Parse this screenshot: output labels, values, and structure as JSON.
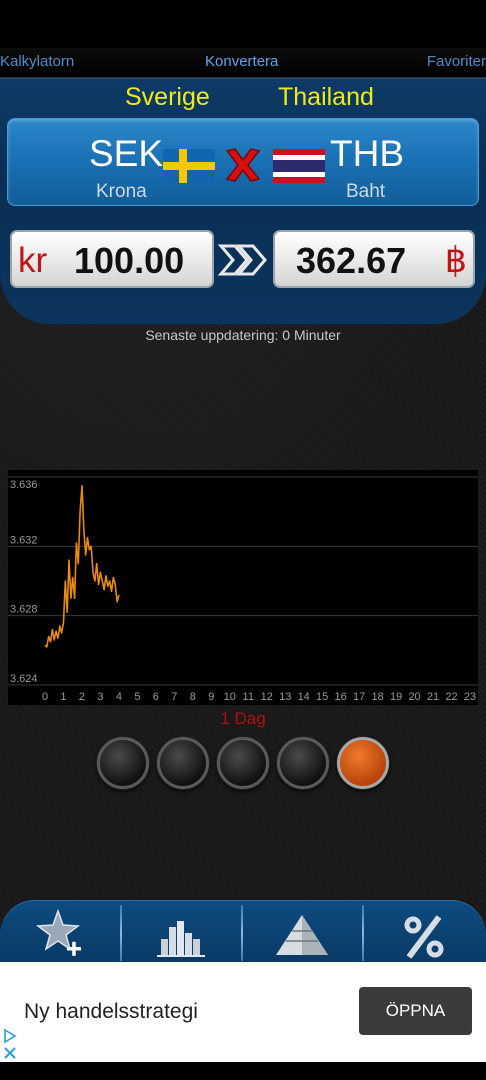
{
  "top_nav": {
    "left": "Kalkylatorn",
    "center": "Konvertera",
    "right": "Favoriter"
  },
  "pair": {
    "from": {
      "country": "Sverige",
      "code": "SEK",
      "name": "Krona",
      "symbol": "kr",
      "amount": "100.00"
    },
    "to": {
      "country": "Thailand",
      "code": "THB",
      "name": "Baht",
      "symbol": "฿",
      "amount": "362.67"
    }
  },
  "updated": "Senaste uppdatering: 0 Minuter",
  "chart_data": {
    "type": "line",
    "x": [
      0.0,
      0.1,
      0.2,
      0.3,
      0.4,
      0.5,
      0.6,
      0.7,
      0.8,
      0.9,
      1.0,
      1.1,
      1.2,
      1.3,
      1.4,
      1.5,
      1.6,
      1.7,
      1.8,
      1.9,
      2.0,
      2.1,
      2.2,
      2.3,
      2.4,
      2.5,
      2.6,
      2.7,
      2.8,
      2.9,
      3.0,
      3.1,
      3.2,
      3.3,
      3.4,
      3.5,
      3.6,
      3.7,
      3.8,
      3.9,
      4.0
    ],
    "y": [
      3.6263,
      3.6262,
      3.6268,
      3.6265,
      3.6272,
      3.6266,
      3.6271,
      3.6267,
      3.6274,
      3.627,
      3.6276,
      3.63,
      3.6282,
      3.6312,
      3.629,
      3.6302,
      3.629,
      3.6322,
      3.631,
      3.634,
      3.6355,
      3.633,
      3.6315,
      3.6325,
      3.6318,
      3.632,
      3.6305,
      3.63,
      3.631,
      3.6298,
      3.6305,
      3.63,
      3.6295,
      3.6303,
      3.6297,
      3.63,
      3.6294,
      3.6302,
      3.6298,
      3.6288,
      3.6292
    ],
    "ylim": [
      3.624,
      3.636
    ],
    "y_ticks": [
      "3.624",
      "3.628",
      "3.632",
      "3.636"
    ],
    "x_ticks": [
      "0",
      "1",
      "2",
      "3",
      "4",
      "5",
      "6",
      "7",
      "8",
      "9",
      "10",
      "11",
      "12",
      "13",
      "14",
      "15",
      "16",
      "17",
      "18",
      "19",
      "20",
      "21",
      "22",
      "23"
    ],
    "xlim": [
      0,
      23
    ],
    "grid": true,
    "line_color": "#e88a10"
  },
  "period_label": "1 Dag",
  "period_buttons": [
    {
      "name": "period-button-1",
      "active": false
    },
    {
      "name": "period-button-2",
      "active": false
    },
    {
      "name": "period-button-3",
      "active": false
    },
    {
      "name": "period-button-4",
      "active": false
    },
    {
      "name": "period-button-5",
      "active": true
    }
  ],
  "tabs": [
    {
      "icon": "star-add-icon"
    },
    {
      "icon": "bar-chart-icon"
    },
    {
      "icon": "pyramid-icon"
    },
    {
      "icon": "percent-icon"
    }
  ],
  "ad": {
    "text": "Ny handelsstrategi",
    "button": "ÖPPNA"
  },
  "colors": {
    "accent_blue": "#1970b3",
    "country_yellow": "#f0ea1b",
    "symbol_red": "#c01515",
    "period_red": "#b00f0f"
  }
}
